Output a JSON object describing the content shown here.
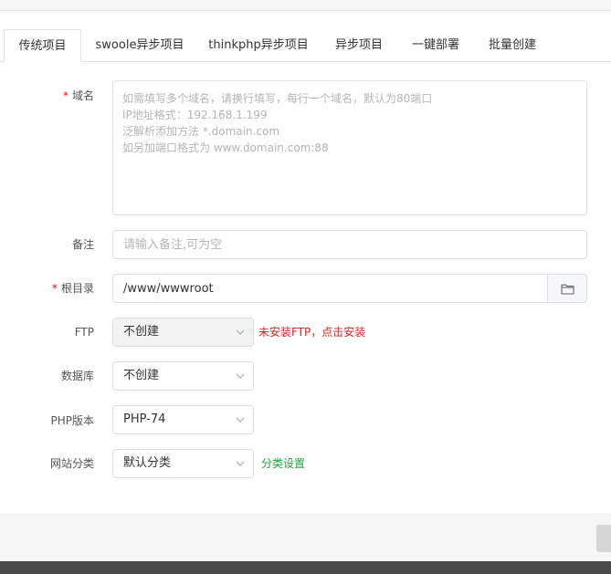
{
  "tabs": [
    {
      "label": "传统项目",
      "active": true
    },
    {
      "label": "swoole异步项目"
    },
    {
      "label": "thinkphp异步项目"
    },
    {
      "label": "异步项目"
    },
    {
      "label": "一键部署"
    },
    {
      "label": "批量创建"
    }
  ],
  "form": {
    "required_mark": "*",
    "domain": {
      "label": "域名",
      "placeholder": "如需填写多个域名，请换行填写，每行一个域名，默认为80端口\nIP地址格式：192.168.1.199\n泛解析添加方法 *.domain.com\n如另加端口格式为 www.domain.com:88"
    },
    "note": {
      "label": "备注",
      "placeholder": "请输入备注,可为空"
    },
    "root": {
      "label": "根目录",
      "value": "/www/wwwroot",
      "icon": "folder-icon"
    },
    "ftp": {
      "label": "FTP",
      "selected": "不创建",
      "disabled": true,
      "hint": "未安装FTP，点击安装"
    },
    "database": {
      "label": "数据库",
      "selected": "不创建"
    },
    "php": {
      "label": "PHP版本",
      "selected": "PHP-74"
    },
    "category": {
      "label": "网站分类",
      "selected": "默认分类",
      "link": "分类设置"
    }
  },
  "colors": {
    "required": "#ef0808",
    "warning_link": "#e02020",
    "accent_link": "#20a53a"
  }
}
